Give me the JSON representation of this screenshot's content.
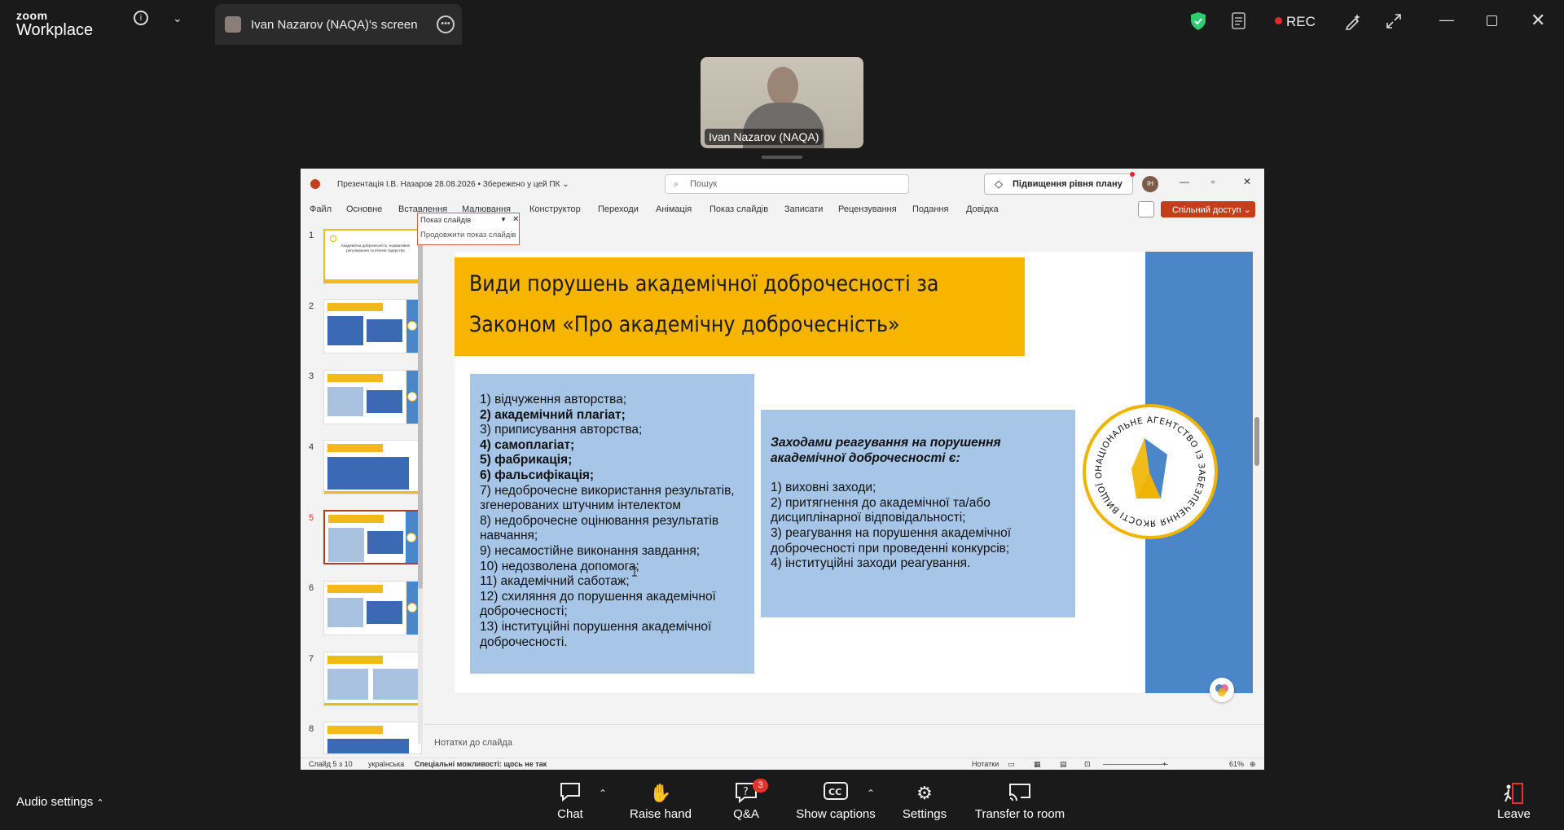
{
  "app": {
    "brand_top": "zoom",
    "brand_bottom": "Workplace",
    "info_icon": "info-icon",
    "rec_label": "REC"
  },
  "share_tab": {
    "label": "Ivan Nazarov (NAQA)'s screen"
  },
  "video": {
    "participant_name": "Ivan Nazarov (NAQA)"
  },
  "ppt": {
    "file_title": "Презентація І.В. Назаров 28.08.2026 • Збережено у цей ПК ⌄",
    "search_placeholder": "Пошук",
    "upgrade_label": "Підвищення рівня плану",
    "avatar_initials": "ІН",
    "menu": [
      "Файл",
      "Основне",
      "Вставлення",
      "Малювання",
      "Конструктор",
      "Переходи",
      "Анімація",
      "Показ слайдів",
      "Записати",
      "Рецензування",
      "Подання",
      "Довідка"
    ],
    "share_label": "Спільний доступ",
    "tooltip": {
      "title": "Показ слайдів",
      "action": "Продовжити показ слайдів"
    },
    "thumb_numbers": [
      "1",
      "2",
      "3",
      "4",
      "5",
      "6",
      "7",
      "8"
    ],
    "thumb1_title": "Академічна доброчесність: нормативне регулювання та етичне лідерство",
    "notes_label": "Нотатки до слайда",
    "status": {
      "slide": "Слайд 5 з 10",
      "language": "українська",
      "accessibility": "Спеціальні можливості: щось не так",
      "notes": "Нотатки",
      "zoom": "61%"
    }
  },
  "slide": {
    "title_line1": "Види порушень академічної доброчесності за",
    "title_line2": "Законом «Про академічну доброчесність»",
    "list_items": [
      "1) відчуження авторства;",
      "2) академічний плагіат;",
      "3) приписування авторства;",
      "4) самоплагіат;",
      "5) фабрикація;",
      "6) фальсифікація;",
      "7) недоброчесне використання результатів, згенерованих штучним інтелектом",
      "8) недоброчесне оцінювання результатів навчання;",
      "9) несамостійне виконання завдання;",
      "10) недозволена допомога;",
      "11) академічний саботаж;",
      "12) схиляння до порушення академічної доброчесності;",
      "13) інституційні порушення академічної доброчесності."
    ],
    "right_header": "Заходами реагування на порушення академічної доброчесності є:",
    "right_items": [
      "1) виховні заходи;",
      "2) притягнення до академічної та/або дисциплінарної відповідальності;",
      "3) реагування на порушення академічної доброчесності при проведенні конкурсів;",
      "4) інституційні заходи реагування."
    ],
    "seal_text": "НАЦІОНАЛЬНЕ АГЕНТСТВО ІЗ ЗАБЕЗПЕЧЕННЯ ЯКОСТІ ВИЩОЇ ОСВІТИ"
  },
  "toolbar": {
    "audio_label": "Audio settings",
    "chat": "Chat",
    "raise_hand": "Raise hand",
    "qa": "Q&A",
    "qa_badge": "3",
    "captions": "Show captions",
    "settings": "Settings",
    "transfer": "Transfer to room",
    "leave": "Leave"
  },
  "colors": {
    "slide_title_bg": "#f7b500",
    "slide_box_bg": "#a7c5e6",
    "slide_bar": "#4a86c8",
    "share_btn": "#c43e1c",
    "rec_dot": "#e02a2a",
    "shield": "#2ecc71"
  }
}
